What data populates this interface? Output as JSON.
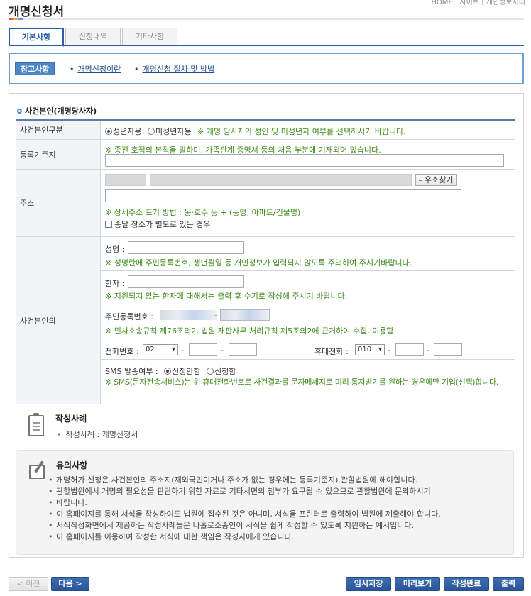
{
  "header": {
    "title": "개명신청서",
    "top_nav": "HOME  |  사이트  |  개인정보처리"
  },
  "tabs": [
    {
      "label": "기본사항",
      "active": true
    },
    {
      "label": "신청내역",
      "active": false
    },
    {
      "label": "기타사항",
      "active": false
    }
  ],
  "reference": {
    "badge": "참고사항",
    "links": [
      "개명신청이란",
      "개명신청 절차 및 방법"
    ]
  },
  "section": {
    "title": "사건본인(개명당사자)"
  },
  "form": {
    "category": {
      "label": "사건본인구분",
      "options": [
        "성년자용",
        "미성년자용"
      ],
      "selected": "성년자용",
      "help": "※ 개명 당사자의 성인 및 미성년자 여부를 선택하시기 바랍니다."
    },
    "registry": {
      "label": "등록기준지",
      "help": "※ 종전 호적의 본적을 말하며, 가족관계 증명서 등의 처음 부분에 기재되어 있습니다."
    },
    "address": {
      "label": "주소",
      "zip_button": "우소찾기",
      "help": "※ 상세주소 표기 방법 : 동·호수 등 + (동명, 아파트/건물명)",
      "delivery_checkbox": "송달 장소가 별도로 있는 경우"
    },
    "person": {
      "label": "사건본인의",
      "name_label": "성명 :",
      "name_help": "※ 성명란에 주민등록번호, 생년월일 등 개인정보가 입력되지 않도록 주의하여 주시기바랍니다.",
      "hanja_label": "한자 :",
      "hanja_help": "※ 지원되지 않는 한자에 대해서는 출력 후 수기로 작성해 주시기 바랍니다.",
      "rrn_label": "주민등록번호 :",
      "rrn_help": "※ 민사소송규칙 제76조의2, 법원 재판사무 처리규칙 제5조의2에 근거하여 수집, 이용함",
      "phone_label": "전화번호 :",
      "phone_area": "02",
      "mobile_label": "휴대전화 :",
      "mobile_prefix": "010",
      "dash": "-",
      "sms_label": "SMS 발송여부 :",
      "sms_options": [
        "신청안함",
        "신청함"
      ],
      "sms_selected": "신청안함",
      "sms_help": "※ SMS(문자전송서비스)는 위 휴대전화번호로 사건결과를 문자메세지로 미리 통지받기를 원하는 경우에만 기입(선택)합니다."
    }
  },
  "example": {
    "title": "작성사례",
    "link": "작성사례 : 개명신청서"
  },
  "notice": {
    "title": "유의사항",
    "items": [
      "개명허가 신청은 사건본인의 주소지(재외국민이거나 주소가 없는 경우에는 등록기준지) 관할법원에 해야합니다.",
      "관할법원에서 개명의 필요성을 판단하기 위한 자료로 기타서면의 첨부가 요구될 수 있으므로 관할법원에 문의하시기",
      "바랍니다.",
      "이 홈페이지를 통해 서식을 작성하여도 법원에 접수된 것은 아니며, 서식을 프린터로 출력하여 법원에 제출해야 합니다.",
      "서식작성화면에서 제공하는 작성사례들은 나홀로소송인이 서식을 쉽게 작성할 수 있도록 지원하는 예시입니다.",
      "이 홈페이지를 이용하여 작성한 서식에 대한 책임은 작성자에게 있습니다."
    ]
  },
  "buttons": {
    "prev": "< 이전",
    "next": "다음 >",
    "temp_save": "임시저장",
    "preview": "미리보기",
    "complete": "작성완료",
    "print": "출력"
  },
  "colors": {
    "primary": "#2a5ea8",
    "help_green": "#3d8b1a",
    "label_bg": "#f2f4f7"
  }
}
